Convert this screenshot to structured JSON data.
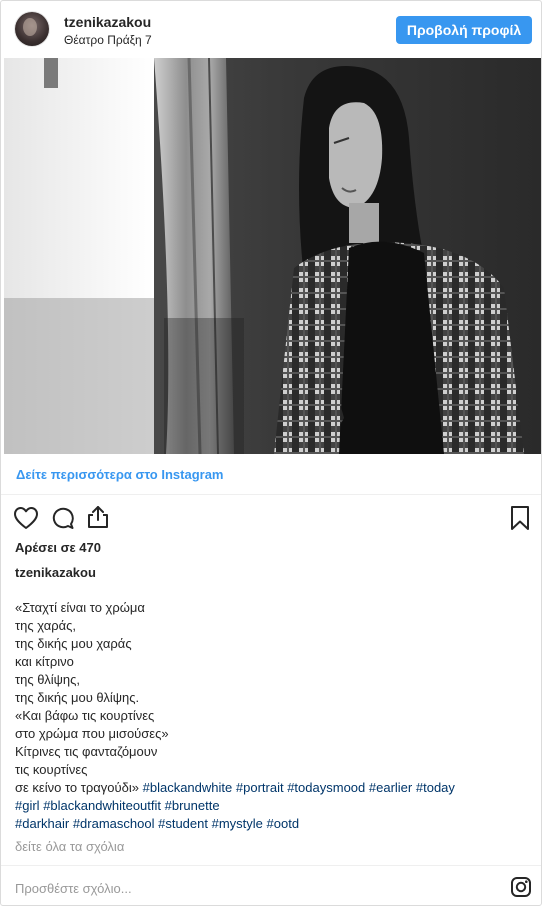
{
  "header": {
    "username": "tzenikazakou",
    "location": "Θέατρο Πράξη 7",
    "view_profile_label": "Προβολή προφίλ"
  },
  "post": {
    "see_more_label": "Δείτε περισσότερα στο Instagram",
    "likes_text": "Αρέσει σε 470",
    "caption_user": "tzenikazakou",
    "caption_lines": [
      "«Σταχτί είναι το χρώμα",
      "της χαράς,",
      "της δικής μου χαράς",
      "και κίτρινο",
      "της θλίψης,",
      "της δικής μου θλίψης.",
      "«Και βάφω τις κουρτίνες",
      "στο χρώμα που μισούσες»",
      "Κίτρινες τις φανταζόμουν",
      "τις κουρτίνες"
    ],
    "caption_last_text": "σε κείνο το τραγούδι»",
    "hashtags": {
      "line1": [
        "#blackandwhite",
        "#portrait",
        "#todaysmood",
        "#earlier",
        "#today"
      ],
      "line2": [
        "#girl",
        "#blackandwhiteoutfit",
        "#brunette"
      ],
      "line3": [
        "#darkhair",
        "#dramaschool",
        "#student",
        "#mystyle",
        "#ootd"
      ]
    },
    "view_all_comments_label": "δείτε όλα τα σχόλια"
  },
  "comment": {
    "placeholder": "Προσθέστε σχόλιο..."
  },
  "icons": {
    "like": "heart-icon",
    "comment": "comment-bubble-icon",
    "share": "share-icon",
    "save": "bookmark-icon",
    "instagram": "instagram-logo-icon"
  },
  "colors": {
    "accent": "#3897f0",
    "hashtag": "#003569",
    "muted": "#999999",
    "text": "#262626"
  }
}
